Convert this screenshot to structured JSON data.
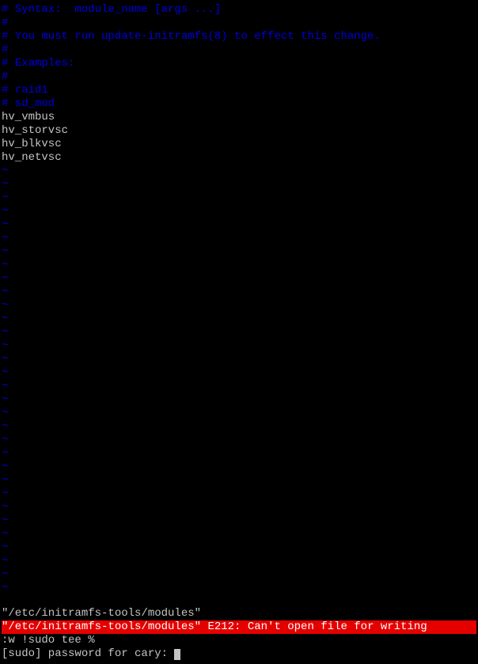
{
  "editor": {
    "comments": [
      "# Syntax:  module_name [args ...]",
      "#",
      "# You must run update-initramfs(8) to effect this change.",
      "#",
      "# Examples:",
      "#",
      "# raid1",
      "# sd_mod"
    ],
    "modules": [
      "hv_vmbus",
      "hv_storvsc",
      "hv_blkvsc",
      "hv_netvsc"
    ],
    "empty_tildes_count": 32
  },
  "status": {
    "filename": "\"/etc/initramfs-tools/modules\"",
    "error": "\"/etc/initramfs-tools/modules\" E212: Can't open file for writing",
    "command": ":w !sudo tee %",
    "prompt": "[sudo] password for cary: "
  }
}
